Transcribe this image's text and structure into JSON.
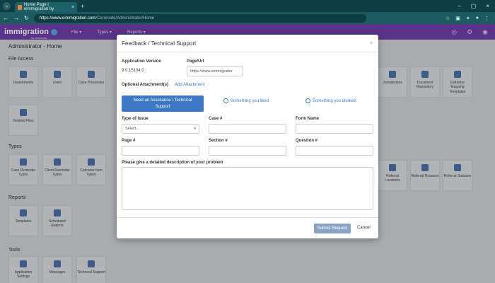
{
  "browser": {
    "tab_title": "Home Page | eimmigration by",
    "url_host": "https://www.eimmigration.com",
    "url_path": "/Cerenade/Administrator/Home",
    "new_tab": "+",
    "back_icon": "back-arrow-icon"
  },
  "app": {
    "logo": "immigration",
    "logo_sub": "by cerenade",
    "menu": [
      "File ▾",
      "Types ▾",
      "Reports ▾"
    ]
  },
  "page": {
    "title": "Administrator - Home",
    "sections": [
      "File Access",
      "Types",
      "Reports",
      "Tools"
    ],
    "file_tiles": [
      "Departments",
      "Users",
      "Case Processes",
      "C...",
      "Deleted Files"
    ],
    "file_tiles_right": [
      "Jurisdictions",
      "Document Repository",
      "Extractor Mapping Templates"
    ],
    "type_tiles": [
      "Case Reminder Types",
      "Client Reminder Types",
      "Calendar Item Types",
      "Bl..."
    ],
    "type_tiles_right": [
      "Referral Locations",
      "Referral Reasons",
      "Referral Statuses"
    ],
    "report_tiles": [
      "Templates",
      "Scheduled Reports"
    ],
    "tool_tiles": [
      "Application Settings",
      "Messages",
      "Technical Support"
    ]
  },
  "modal": {
    "title": "Feedback / Technical Support",
    "close": "×",
    "app_version_label": "Application Version",
    "app_version_value": "9.0.15104.0",
    "page_url_label": "Page/Url",
    "page_url_value": "https://www.eimmigratior",
    "attachments_label": "Optional Attachment(s)",
    "add_attachment": "Add Attachment",
    "options": {
      "assistance": "Need an Assistance / Technical Support",
      "liked": "Something you liked",
      "disliked": "Something you disliked"
    },
    "fields": {
      "type_of_issue": "Type of Issue",
      "type_placeholder": "Select...",
      "case": "Case #",
      "form_name": "Form Name",
      "page": "Page #",
      "section": "Section #",
      "question": "Question #",
      "description": "Please give a detailed description of your problem"
    },
    "submit": "Submit Request",
    "cancel": "Cancel"
  },
  "colors": {
    "app_purple": "#6c3fa8",
    "primary_blue": "#3c78c3",
    "browser_teal": "#0f3e43"
  }
}
